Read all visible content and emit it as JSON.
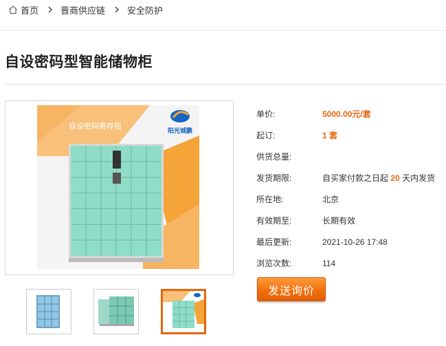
{
  "breadcrumb": {
    "home": "首页",
    "category": "晋商供应链",
    "current": "安全防护"
  },
  "product": {
    "title": "自设密码型智能储物柜",
    "image_banner_text": "自设密码寄存柜",
    "brand_logo_text": "阳光城鹏",
    "thumbnails": [
      {
        "alt": "locker-front",
        "active": false
      },
      {
        "alt": "locker-pair",
        "active": false
      },
      {
        "alt": "locker-main",
        "active": true
      }
    ]
  },
  "specs": {
    "price_label": "单价:",
    "price_value": "5000.00元/套",
    "moq_label": "起订:",
    "moq_number": "1",
    "moq_unit": "套",
    "supply_label": "供货总量:",
    "supply_value": "",
    "delivery_label": "发货期限:",
    "delivery_prefix": "自买家付款之日起",
    "delivery_days": "20",
    "delivery_suffix": "天内发货",
    "location_label": "所在地:",
    "location_value": "北京",
    "validity_label": "有效期至:",
    "validity_value": "长期有效",
    "updated_label": "最后更新:",
    "updated_value": "2021-10-26 17:48",
    "views_label": "浏览次数:",
    "views_value": "114"
  },
  "inquiry_button": "发送询价",
  "colors": {
    "accent": "#e8650a",
    "locker_door": "#8fdcc7",
    "banner_orange": "#f5a43a"
  },
  "icons": {
    "home": "home-icon",
    "separator": "chevron-right-icon"
  }
}
